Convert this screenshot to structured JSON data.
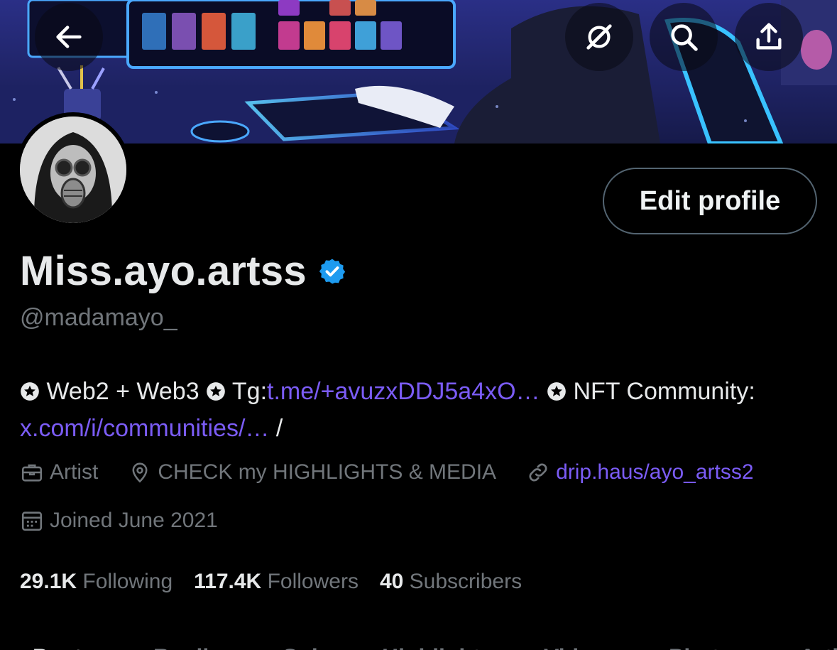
{
  "profile": {
    "display_name": "Miss.ayo.artss",
    "handle": "@madamayo_",
    "edit_label": "Edit profile"
  },
  "bio": {
    "part1": "Web2 + Web3",
    "part2": "Tg:",
    "link1": "t.me/+avuzxDDJ5a4xO…",
    "part3": "NFT Community:",
    "link2": "x.com/i/communities/…",
    "part4": "/"
  },
  "meta": {
    "profession": "Artist",
    "location": "CHECK my HIGHLIGHTS & MEDIA",
    "website": "drip.haus/ayo_artss2",
    "joined": "Joined June 2021"
  },
  "stats": {
    "following_count": "29.1K",
    "following_label": "Following",
    "followers_count": "117.4K",
    "followers_label": "Followers",
    "subscribers_count": "40",
    "subscribers_label": "Subscribers"
  },
  "tabs": [
    "Posts",
    "Replies",
    "Subs",
    "Highlights",
    "Videos",
    "Photos",
    "Articles"
  ],
  "icons": {
    "back": "back-arrow-icon",
    "grok": "grok-icon",
    "search": "search-icon",
    "share": "share-icon",
    "verified": "verified-badge-icon",
    "profession": "briefcase-icon",
    "location": "location-pin-icon",
    "website": "link-icon",
    "joined": "calendar-icon"
  },
  "colors": {
    "link": "#7b5cf6",
    "verified": "#1d9bf0",
    "muted": "#71767b",
    "background": "#000000"
  }
}
